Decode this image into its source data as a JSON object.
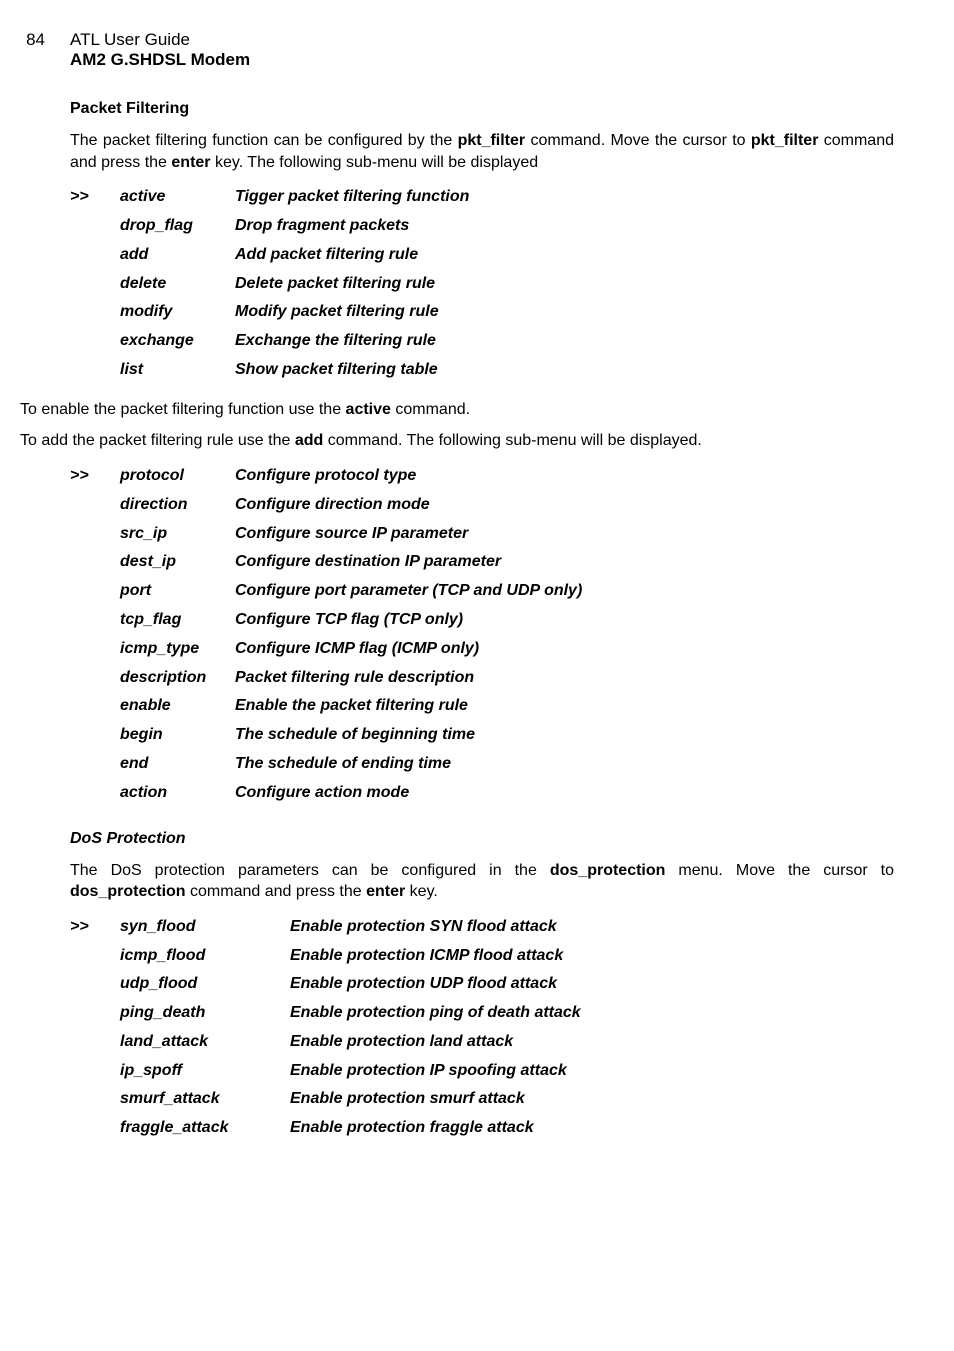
{
  "header": {
    "pageNumber": "84",
    "guideTitle": "ATL User Guide",
    "modemTitle": "AM2 G.SHDSL Modem"
  },
  "packetFiltering": {
    "heading": "Packet Filtering",
    "intro_pre": "The packet filtering function can be configured by the ",
    "intro_cmd1": "pkt_filter",
    "intro_mid": " command. Move the cursor to ",
    "intro_cmd2": "pkt_filter",
    "intro_post1": " command and press the ",
    "intro_enter": "enter",
    "intro_post2": " key. The following sub-menu will be displayed",
    "menu1": [
      {
        "prompt": ">>",
        "name": "active",
        "desc": "Tigger packet filtering function"
      },
      {
        "prompt": "",
        "name": "drop_flag",
        "desc": "Drop fragment packets"
      },
      {
        "prompt": "",
        "name": "add",
        "desc": "Add packet filtering rule"
      },
      {
        "prompt": "",
        "name": "delete",
        "desc": "Delete packet filtering rule"
      },
      {
        "prompt": "",
        "name": "modify",
        "desc": "Modify packet filtering rule"
      },
      {
        "prompt": "",
        "name": "exchange",
        "desc": "Exchange the filtering rule"
      },
      {
        "prompt": "",
        "name": "list",
        "desc": "Show packet filtering table"
      }
    ],
    "enable_pre": "To enable the packet filtering function use the ",
    "enable_cmd": "active",
    "enable_post": " command.",
    "add_pre": " To add the packet filtering rule use the ",
    "add_cmd": "add",
    "add_post": " command. The following sub-menu will be displayed.",
    "menu2": [
      {
        "prompt": ">>",
        "name": "protocol",
        "desc": "Configure protocol type"
      },
      {
        "prompt": "",
        "name": "direction",
        "desc": "Configure direction mode"
      },
      {
        "prompt": "",
        "name": "src_ip",
        "desc": "Configure source IP parameter"
      },
      {
        "prompt": "",
        "name": "dest_ip",
        "desc": "Configure destination IP parameter"
      },
      {
        "prompt": "",
        "name": "port",
        "desc": "Configure port parameter (TCP and UDP only)"
      },
      {
        "prompt": "",
        "name": "tcp_flag",
        "desc": "Configure TCP flag (TCP only)"
      },
      {
        "prompt": "",
        "name": "icmp_type",
        "desc": "Configure ICMP flag (ICMP only)"
      },
      {
        "prompt": "",
        "name": "description",
        "desc": "Packet filtering rule description"
      },
      {
        "prompt": "",
        "name": "enable",
        "desc": "Enable the packet filtering rule"
      },
      {
        "prompt": "",
        "name": "begin",
        "desc": "The schedule of beginning time"
      },
      {
        "prompt": "",
        "name": "end",
        "desc": "The schedule of ending time"
      },
      {
        "prompt": "",
        "name": "action",
        "desc": "Configure action mode"
      }
    ]
  },
  "dos": {
    "heading": "DoS Protection",
    "intro_pre": "The DoS protection parameters can be configured in the ",
    "intro_cmd1": "dos_protection",
    "intro_mid": " menu. Move the cursor to ",
    "intro_cmd2": "dos_protection",
    "intro_post1": " command and press the ",
    "intro_enter": "enter",
    "intro_post2": " key.",
    "menu": [
      {
        "prompt": ">>",
        "name": "syn_flood",
        "desc": "Enable protection SYN flood attack"
      },
      {
        "prompt": "",
        "name": "icmp_flood",
        "desc": "Enable protection ICMP flood attack"
      },
      {
        "prompt": "",
        "name": "udp_flood",
        "desc": "Enable protection UDP flood attack"
      },
      {
        "prompt": "",
        "name": "ping_death",
        "desc": "Enable protection ping of death attack"
      },
      {
        "prompt": "",
        "name": "land_attack",
        "desc": "Enable protection land attack"
      },
      {
        "prompt": "",
        "name": "ip_spoff",
        "desc": "Enable protection IP spoofing attack"
      },
      {
        "prompt": "",
        "name": "smurf_attack",
        "desc": "Enable protection smurf attack"
      },
      {
        "prompt": "",
        "name": "fraggle_attack",
        "desc": "Enable protection fraggle attack"
      }
    ]
  }
}
